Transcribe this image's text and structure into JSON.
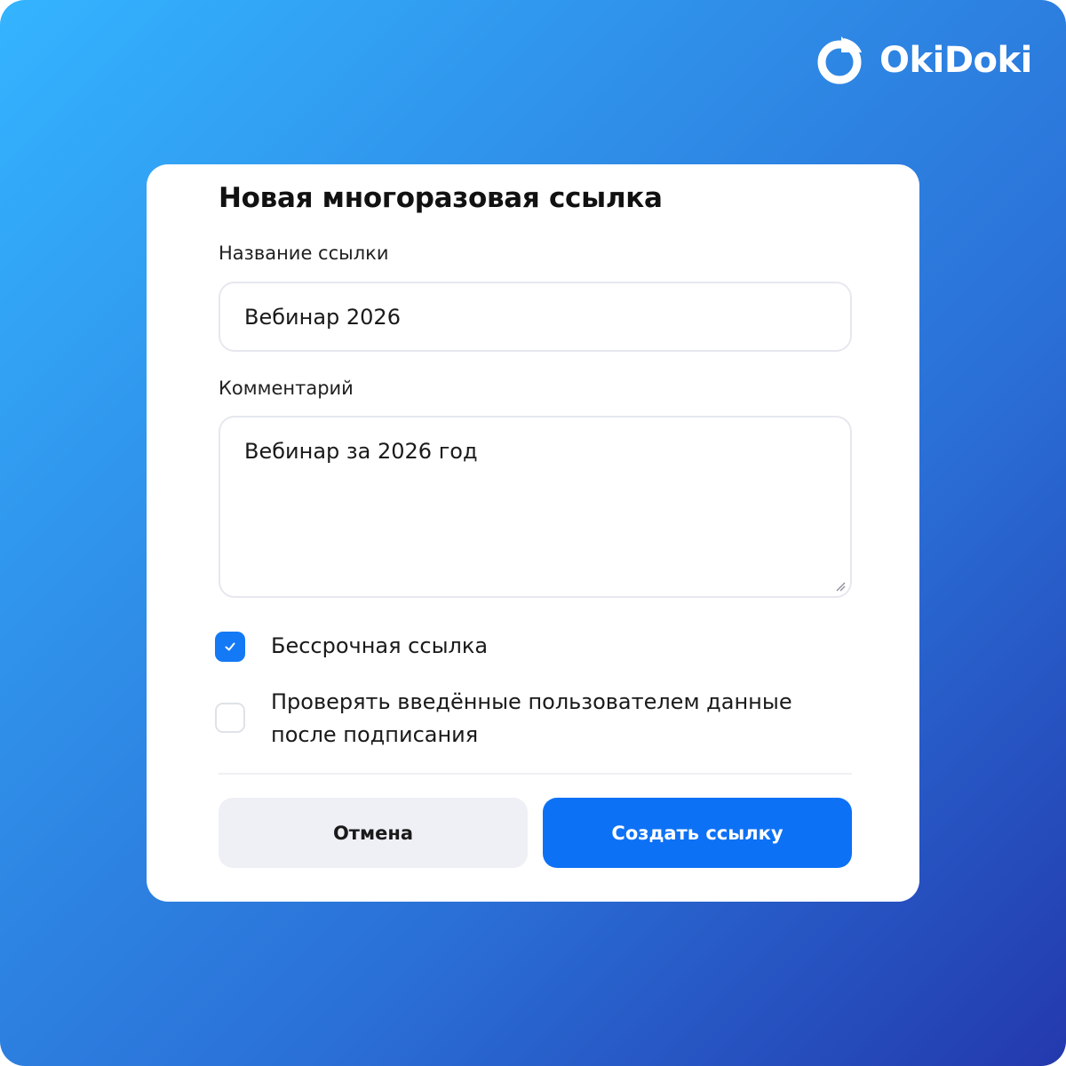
{
  "brand": {
    "name": "OkiDoki",
    "logo_icon": "okidoki-logo-icon",
    "accent_color": "#1479f5"
  },
  "dialog": {
    "title": "Новая многоразовая ссылка",
    "fields": {
      "link_name": {
        "label": "Название ссылки",
        "value": "Вебинар 2026"
      },
      "comment": {
        "label": "Комментарий",
        "value": "Вебинар за 2026 год"
      }
    },
    "options": [
      {
        "label": "Бессрочная ссылка",
        "checked": true
      },
      {
        "label": "Проверять введённые пользователем данные после подписания",
        "checked": false
      }
    ],
    "buttons": {
      "cancel": "Отмена",
      "create": "Создать ссылку"
    }
  }
}
